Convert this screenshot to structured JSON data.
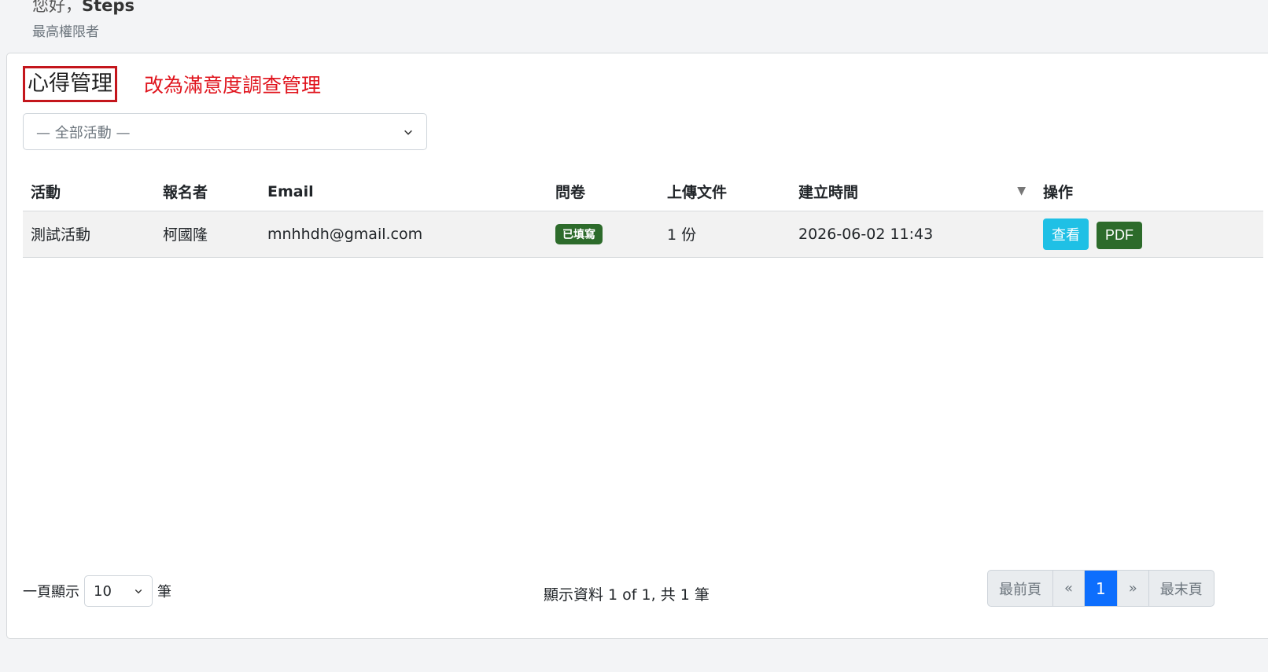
{
  "header": {
    "greeting_prefix": "您好，",
    "user_name": "Steps",
    "role": "最高權限者"
  },
  "page": {
    "title": "心得管理",
    "annotation": "改為滿意度調查管理"
  },
  "filter": {
    "selected": "— 全部活動 —"
  },
  "table": {
    "headers": [
      "活動",
      "報名者",
      "Email",
      "問卷",
      "上傳文件",
      "建立時間",
      "操作"
    ],
    "sort_indicator": "▼",
    "rows": [
      {
        "activity": "測試活動",
        "registrant": "柯國隆",
        "email": "mnhhdh@gmail.com",
        "questionnaire": "已填寫",
        "uploads": "1 份",
        "created": "2026-06-02 11:43",
        "view_label": "查看",
        "pdf_label": "PDF"
      }
    ]
  },
  "footer": {
    "per_page_prefix": "一頁顯示",
    "per_page_value": "10",
    "per_page_suffix": "筆",
    "info": "顯示資料 1 of 1, 共 1 筆",
    "pager": {
      "first": "最前頁",
      "prev": "«",
      "current": "1",
      "next": "»",
      "last": "最末頁"
    }
  },
  "colors": {
    "accent": "#0d6efd",
    "annotation": "#e0141d",
    "badge": "#2d6b2b",
    "view_button": "#1fc0e5"
  }
}
